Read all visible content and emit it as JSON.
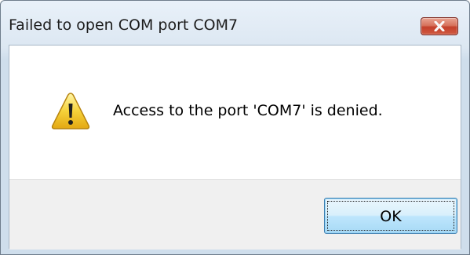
{
  "dialog": {
    "title": "Failed to open COM port COM7",
    "message": "Access to the port 'COM7' is denied.",
    "icon": "warning-icon",
    "ok_label": "OK",
    "close_icon": "close-icon"
  },
  "colors": {
    "close_button": "#c4402b",
    "ok_button_border": "#3c7fb1",
    "warning_yellow": "#f6d23a",
    "button_area_bg": "#f0f0f0"
  }
}
